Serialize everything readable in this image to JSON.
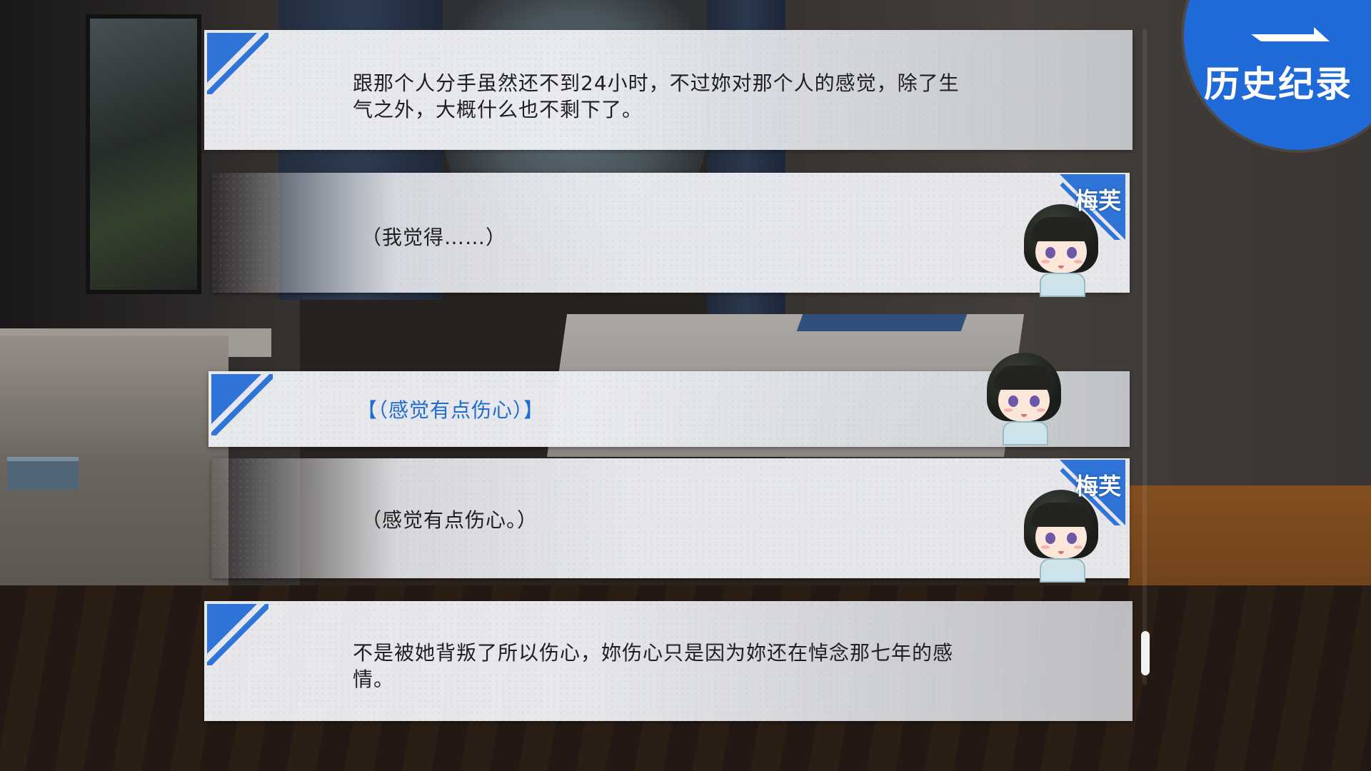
{
  "header": {
    "title": "历史纪录",
    "back_icon": "back-arrow-icon"
  },
  "colors": {
    "accent": "#2f74d6",
    "choice_text": "#1f6bd0",
    "panel": "#eceef2"
  },
  "log": [
    {
      "type": "narration",
      "text_lines": [
        "跟那个人分手虽然还不到24小时，不过妳对那个人的感觉，除了生",
        "气之外，大概什么也不剩下了。"
      ]
    },
    {
      "type": "speaker",
      "speaker": "梅芙",
      "text_lines": [
        "（我觉得……）"
      ]
    },
    {
      "type": "choice",
      "text_lines": [
        "【（感觉有点伤心）】"
      ]
    },
    {
      "type": "speaker",
      "speaker": "梅芙",
      "text_lines": [
        "（感觉有点伤心。）"
      ]
    },
    {
      "type": "narration",
      "text_lines": [
        "不是被她背叛了所以伤心，妳伤心只是因为妳还在悼念那七年的感",
        "情。"
      ]
    }
  ]
}
